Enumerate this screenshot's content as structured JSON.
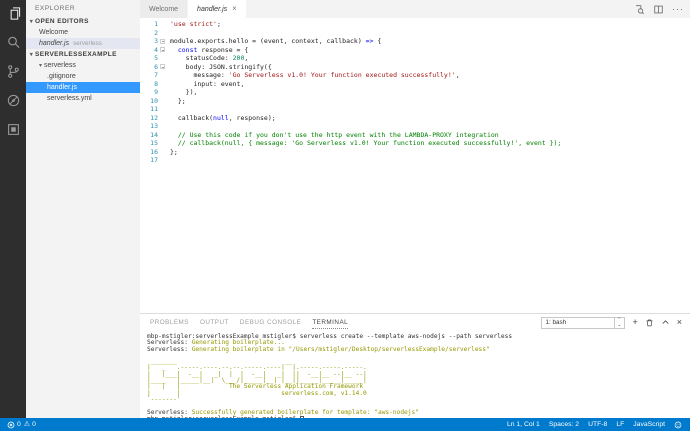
{
  "colors": {
    "accent": "#007acc",
    "selection_blue": "#3399ff",
    "activity_bar_bg": "#2e2e2e",
    "sidebar_bg": "#f3f3f3",
    "terminal_yellow": "#949800",
    "string_red": "#a31515",
    "keyword_blue": "#0000ff",
    "comment_green": "#008000",
    "number_green": "#098658",
    "line_number_blue": "#2b91af"
  },
  "activity_bar": {
    "items": [
      {
        "name": "explorer",
        "active": true
      },
      {
        "name": "search",
        "active": false
      },
      {
        "name": "source-control",
        "active": false
      },
      {
        "name": "debug",
        "active": false
      },
      {
        "name": "extensions",
        "active": false
      }
    ]
  },
  "sidebar": {
    "title": "EXPLORER",
    "open_editors": {
      "header": "OPEN EDITORS",
      "items": [
        {
          "label": "Welcome",
          "suffix": "",
          "active": false,
          "italic": false
        },
        {
          "label": "handler.js",
          "suffix": "serverless",
          "active": true,
          "italic": true
        }
      ]
    },
    "folder_section": {
      "header": "SERVERLESSEXAMPLE",
      "tree": [
        {
          "label": "serverless",
          "indent": 0,
          "caret": true,
          "selected": false
        },
        {
          "label": ".gitignore",
          "indent": 1,
          "caret": false,
          "selected": false
        },
        {
          "label": "handler.js",
          "indent": 1,
          "caret": false,
          "selected": true
        },
        {
          "label": "serverless.yml",
          "indent": 1,
          "caret": false,
          "selected": false
        }
      ]
    }
  },
  "editor_group": {
    "tabs": [
      {
        "label": "Welcome",
        "active": false,
        "close": false,
        "italic": false
      },
      {
        "label": "handler.js",
        "active": true,
        "close": true,
        "italic": true
      }
    ],
    "actions": {
      "close_glyph": "×",
      "more_glyph": "···"
    }
  },
  "editor": {
    "language": "javascript",
    "lines": [
      {
        "n": "1",
        "fold": false,
        "tk": [
          [
            "str",
            "'use strict'"
          ],
          [
            "pln",
            ";"
          ]
        ]
      },
      {
        "n": "2",
        "fold": false,
        "tk": []
      },
      {
        "n": "3",
        "fold": true,
        "tk": [
          [
            "pln",
            "module.exports.hello = (event, context, callback) "
          ],
          [
            "kw",
            "=>"
          ],
          [
            "pln",
            " {"
          ]
        ]
      },
      {
        "n": "4",
        "fold": true,
        "tk": [
          [
            "pln",
            "  "
          ],
          [
            "kw",
            "const"
          ],
          [
            "pln",
            " response = {"
          ]
        ]
      },
      {
        "n": "5",
        "fold": false,
        "tk": [
          [
            "pln",
            "    statusCode: "
          ],
          [
            "num",
            "200"
          ],
          [
            "pln",
            ","
          ]
        ]
      },
      {
        "n": "6",
        "fold": true,
        "tk": [
          [
            "pln",
            "    body: JSON.stringify({"
          ]
        ]
      },
      {
        "n": "7",
        "fold": false,
        "tk": [
          [
            "pln",
            "      message: "
          ],
          [
            "str",
            "'Go Serverless v1.0! Your function executed successfully!'"
          ],
          [
            "pln",
            ","
          ]
        ]
      },
      {
        "n": "8",
        "fold": false,
        "tk": [
          [
            "pln",
            "      input: event,"
          ]
        ]
      },
      {
        "n": "9",
        "fold": false,
        "tk": [
          [
            "pln",
            "    }),"
          ]
        ]
      },
      {
        "n": "10",
        "fold": false,
        "tk": [
          [
            "pln",
            "  };"
          ]
        ]
      },
      {
        "n": "11",
        "fold": false,
        "tk": []
      },
      {
        "n": "12",
        "fold": false,
        "tk": [
          [
            "pln",
            "  callback("
          ],
          [
            "kw",
            "null"
          ],
          [
            "pln",
            ", response);"
          ]
        ]
      },
      {
        "n": "13",
        "fold": false,
        "tk": []
      },
      {
        "n": "14",
        "fold": false,
        "tk": [
          [
            "com",
            "  // Use this code if you don't use the http event with the LAMBDA-PROXY integration"
          ]
        ]
      },
      {
        "n": "15",
        "fold": false,
        "tk": [
          [
            "com",
            "  // callback(null, { message: 'Go Serverless v1.0! Your function executed successfully!', event });"
          ]
        ]
      },
      {
        "n": "16",
        "fold": false,
        "tk": [
          [
            "pln",
            "};"
          ]
        ]
      },
      {
        "n": "17",
        "fold": false,
        "tk": []
      }
    ]
  },
  "panel": {
    "tabs": [
      {
        "label": "PROBLEMS",
        "active": false
      },
      {
        "label": "OUTPUT",
        "active": false
      },
      {
        "label": "DEBUG CONSOLE",
        "active": false
      },
      {
        "label": "TERMINAL",
        "active": true
      }
    ],
    "shell_select_value": "1: bash",
    "terminal_lines": [
      [
        [
          "d",
          "mbp-mstigler:serverlessExample mstigler$ serverless create --template aws-nodejs --path serverless"
        ]
      ],
      [
        [
          "d",
          "Serverless: "
        ],
        [
          "y",
          "Generating boilerplate..."
        ]
      ],
      [
        [
          "d",
          "Serverless: "
        ],
        [
          "y",
          "Generating boilerplate in \"/Users/mstigler/Desktop/serverlessExample/serverless\""
        ]
      ],
      [
        [
          "d",
          ""
        ]
      ],
      [
        [
          "y",
          " _______                             __"
        ]
      ],
      [
        [
          "y",
          "|   _   .-----.----.--.--.-----.----|  |.-----.-----.-----."
        ]
      ],
      [
        [
          "y",
          "|   |___|  -__|   _|  |  |  -__|   _|  ||  -__|__ --|__ --|"
        ]
      ],
      [
        [
          "y",
          "|____   |_____|__|  \\___/|_____|__| |__||_____|_____|_____|"
        ]
      ],
      [
        [
          "y",
          "|   |   |             The Serverless Application Framework"
        ]
      ],
      [
        [
          "y",
          "|       |                           serverless.com, v1.14.0"
        ]
      ],
      [
        [
          "y",
          "`-------'"
        ]
      ],
      [
        [
          "d",
          ""
        ]
      ],
      [
        [
          "d",
          "Serverless: "
        ],
        [
          "y",
          "Successfully generated boilerplate for template: \"aws-nodejs\""
        ]
      ],
      [
        [
          "d",
          "mbp-mstigler:serverlessExample mstigler$ "
        ],
        [
          "c",
          " "
        ]
      ]
    ]
  },
  "status_bar": {
    "errors": "0",
    "warnings": "0",
    "right_items": [
      "Ln 1, Col 1",
      "Spaces: 2",
      "UTF-8",
      "LF",
      "JavaScript"
    ]
  }
}
